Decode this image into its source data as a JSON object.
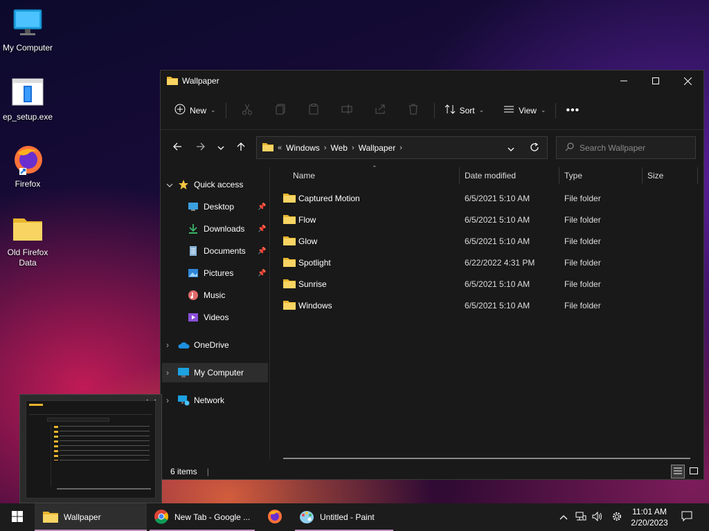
{
  "desktop": {
    "icons": [
      {
        "label": "My Computer",
        "icon": "monitor-icon"
      },
      {
        "label": "ep_setup.exe",
        "icon": "installer-icon"
      },
      {
        "label": "Firefox",
        "icon": "firefox-icon"
      },
      {
        "label": "Old Firefox Data",
        "icon": "folder-icon"
      }
    ]
  },
  "window": {
    "title": "Wallpaper",
    "commands": {
      "new": "New",
      "sort": "Sort",
      "view": "View"
    },
    "address": {
      "overflow": "«",
      "crumbs": [
        "Windows",
        "Web",
        "Wallpaper"
      ]
    },
    "search_placeholder": "Search Wallpaper",
    "nav": {
      "quick_access": "Quick access",
      "items": [
        "Desktop",
        "Downloads",
        "Documents",
        "Pictures",
        "Music",
        "Videos"
      ],
      "onedrive": "OneDrive",
      "my_computer": "My Computer",
      "network": "Network"
    },
    "columns": {
      "name": "Name",
      "date": "Date modified",
      "type": "Type",
      "size": "Size"
    },
    "rows": [
      {
        "name": "Captured Motion",
        "date": "6/5/2021 5:10 AM",
        "type": "File folder"
      },
      {
        "name": "Flow",
        "date": "6/5/2021 5:10 AM",
        "type": "File folder"
      },
      {
        "name": "Glow",
        "date": "6/5/2021 5:10 AM",
        "type": "File folder"
      },
      {
        "name": "Spotlight",
        "date": "6/22/2022 4:31 PM",
        "type": "File folder"
      },
      {
        "name": "Sunrise",
        "date": "6/5/2021 5:10 AM",
        "type": "File folder"
      },
      {
        "name": "Windows",
        "date": "6/5/2021 5:10 AM",
        "type": "File folder"
      }
    ],
    "status": "6 items"
  },
  "taskbar": {
    "items": [
      {
        "label": "Wallpaper",
        "icon": "folder-icon"
      },
      {
        "label": "New Tab - Google ...",
        "icon": "chrome-icon"
      },
      {
        "label": "",
        "icon": "firefox-icon"
      },
      {
        "label": "Untitled - Paint",
        "icon": "paint-icon"
      }
    ],
    "time": "11:01 AM",
    "date": "2/20/2023"
  },
  "colors": {
    "window_bg": "#191919",
    "taskbar_bg": "#1c1c1c",
    "folder": "#f5c542",
    "selection": "#2d2d2d",
    "accent_underline": "#c08fbf"
  }
}
